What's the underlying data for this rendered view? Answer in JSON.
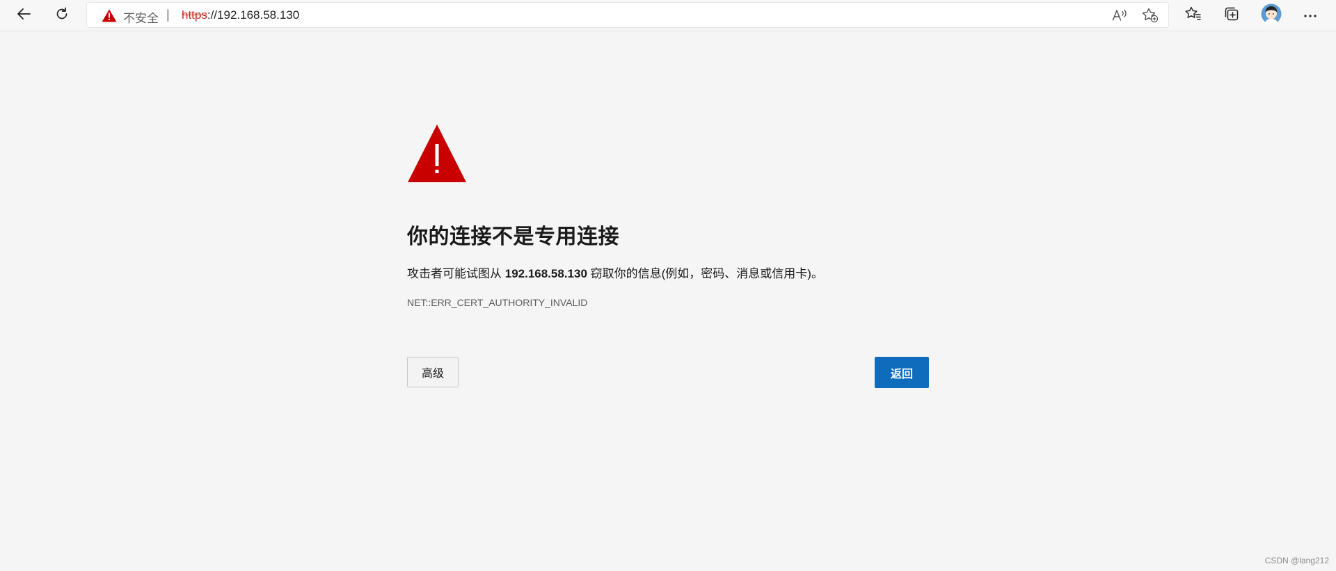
{
  "browser": {
    "address_bar": {
      "security_label": "不安全",
      "separator": "|",
      "url_scheme": "https",
      "url_rest": "://192.168.58.130"
    },
    "icons": {
      "back": "back-arrow-icon",
      "refresh": "refresh-icon",
      "security_warning": "warning-triangle-icon",
      "read_aloud": "read-aloud-icon",
      "add_favorite": "add-favorite-icon",
      "favorites": "favorites-icon",
      "collections": "collections-icon",
      "profile": "profile-avatar",
      "more": "more-menu-icon"
    },
    "colors": {
      "warning_red": "#c80000",
      "accent_blue": "#0f6cbd"
    }
  },
  "error_page": {
    "title": "你的连接不是专用连接",
    "description_prefix": "攻击者可能试图从 ",
    "description_host": "192.168.58.130",
    "description_suffix": " 窃取你的信息(例如，密码、消息或信用卡)。",
    "error_code": "NET::ERR_CERT_AUTHORITY_INVALID",
    "advanced_button": "高级",
    "back_button": "返回"
  },
  "watermark": "CSDN @lang212"
}
